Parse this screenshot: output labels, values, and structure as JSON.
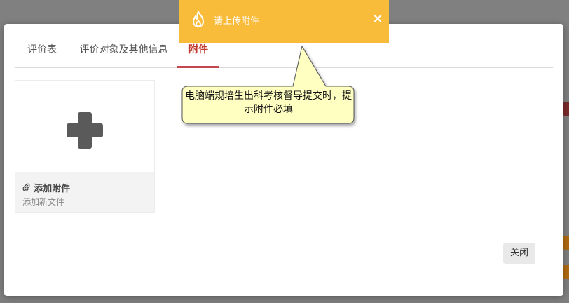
{
  "tabs": [
    {
      "label": "评价表"
    },
    {
      "label": "评价对象及其他信息"
    },
    {
      "label": "附件"
    }
  ],
  "attachment": {
    "title": "添加附件",
    "subtitle": "添加新文件",
    "clip_glyph": "✎"
  },
  "footer": {
    "close_label": "关闭"
  },
  "toast": {
    "message": "请上传附件",
    "close_glyph": "×",
    "icon": "flame-icon",
    "color": "#f9bb3a"
  },
  "callout": {
    "text": "电脑端规培生出科考核督导提交时，提示附件必填"
  },
  "colors": {
    "active_tab": "#c0392b",
    "overlay": "#7f7f7f"
  }
}
